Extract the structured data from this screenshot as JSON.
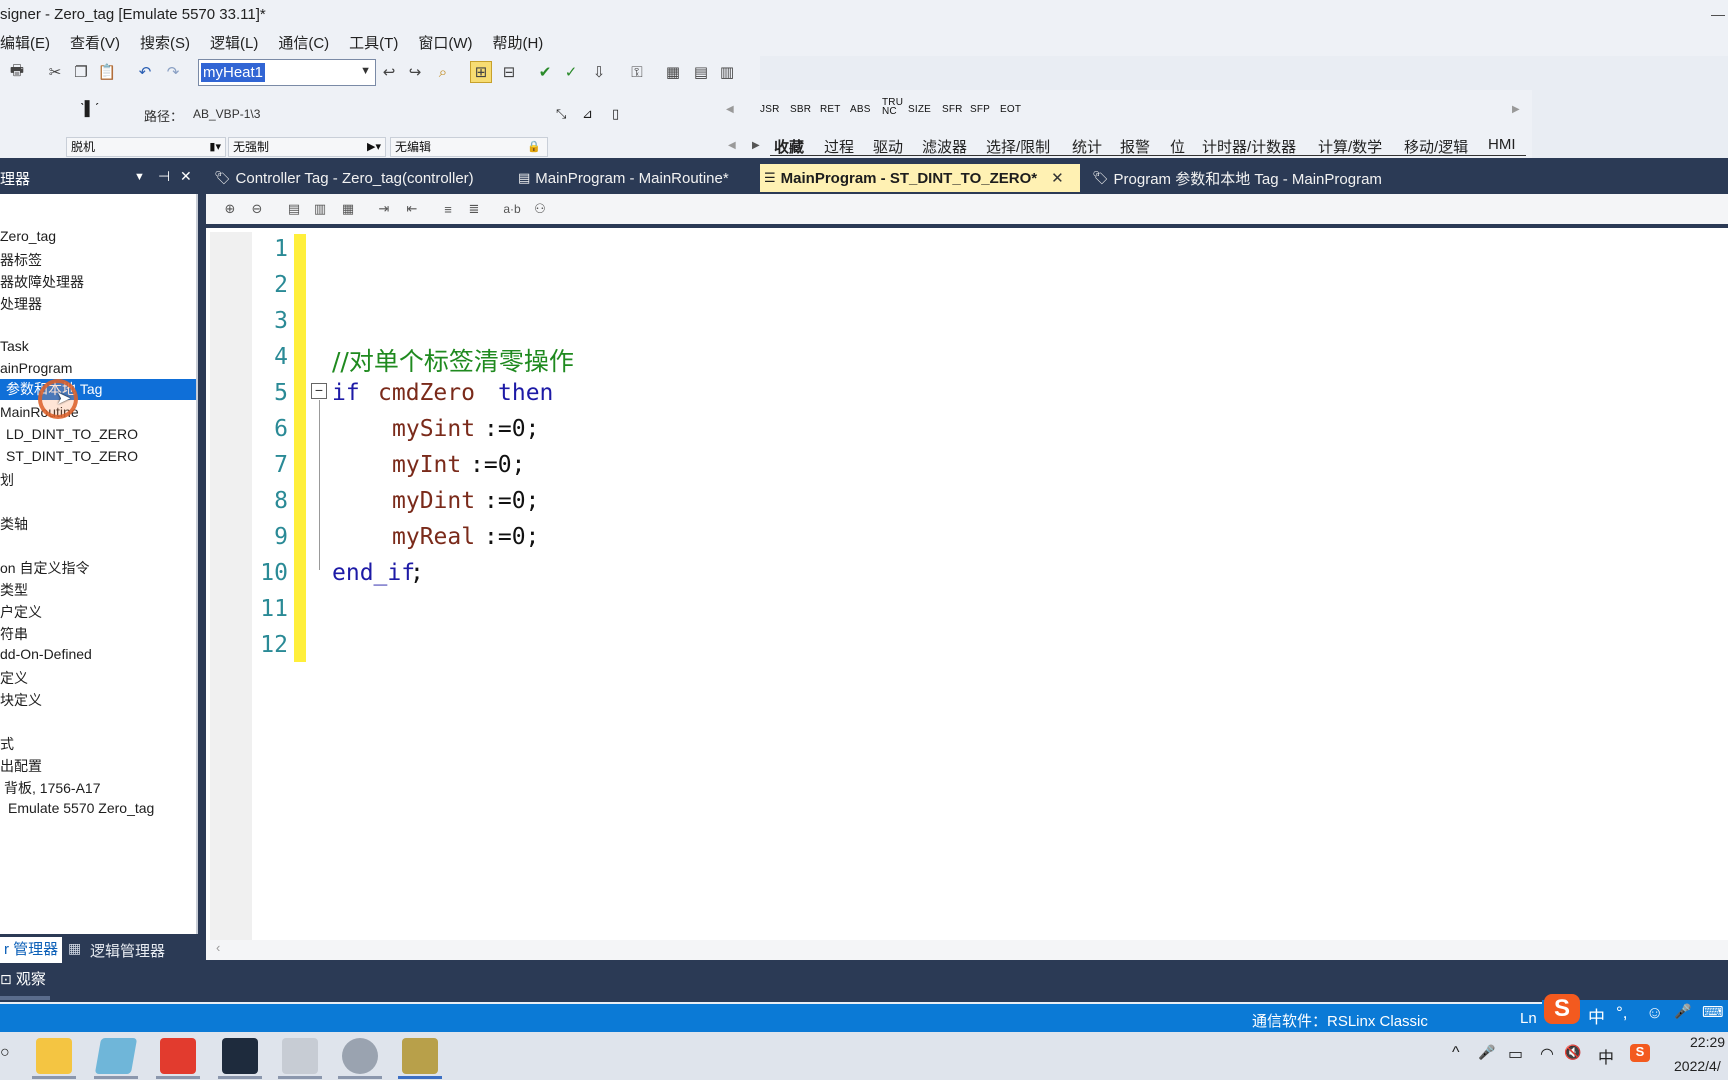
{
  "window": {
    "title": "signer - Zero_tag [Emulate 5570 33.11]*",
    "controls": [
      "—",
      "□"
    ]
  },
  "menu": [
    "编辑(E)",
    "查看(V)",
    "搜索(S)",
    "逻辑(L)",
    "通信(C)",
    "工具(T)",
    "窗口(W)",
    "帮助(H)"
  ],
  "toolbar": {
    "tag_combo_value": "myHeat1"
  },
  "path": {
    "label": "路径：",
    "value": "AB_VBP-1\\3"
  },
  "mode": {
    "run": "脱机",
    "force": "无强制",
    "edit": "无编辑"
  },
  "instructions": {
    "buttons": [
      "JSR",
      "SBR",
      "RET",
      "ABS",
      "TRU NC",
      "SIZE",
      "SFR",
      "SFP",
      "EOT"
    ],
    "tabs": [
      "收藏",
      "过程",
      "驱动",
      "滤波器",
      "选择/限制",
      "统计",
      "报警",
      "位",
      "计时器/计数器",
      "计算/数学",
      "移动/逻辑",
      "HMI"
    ]
  },
  "organizer": {
    "title": "理器",
    "items": [
      "Zero_tag",
      "器标签",
      "器故障处理器",
      "处理器",
      "Task",
      "ainProgram",
      "参数和本地 Tag",
      "MainRoutine",
      "LD_DINT_TO_ZERO",
      "ST_DINT_TO_ZERO",
      "划",
      "类轴",
      "on 自定义指令",
      "类型",
      "户定义",
      "符串",
      "dd-On-Defined",
      "定义",
      "块定义",
      "式",
      "出配置",
      "背板, 1756-A17",
      "Emulate 5570 Zero_tag"
    ],
    "tabs": [
      "r 管理器",
      "逻辑管理器"
    ]
  },
  "doc_tabs": [
    "Controller Tag - Zero_tag(controller)",
    "MainProgram - MainRoutine*",
    "MainProgram - ST_DINT_TO_ZERO*",
    "Program 参数和本地 Tag - MainProgram"
  ],
  "editor": {
    "line_numbers": [
      "1",
      "2",
      "3",
      "4",
      "5",
      "6",
      "7",
      "8",
      "9",
      "10",
      "11",
      "12"
    ],
    "code": {
      "comment": "//对单个标签清零操作",
      "if_kw": "if",
      "cond": "cmdZero",
      "then_kw": "then",
      "l6_var": "mySint",
      "l7_var": "myInt",
      "l8_var": "myDint",
      "l9_var": "myReal",
      "assign": ":=0;",
      "end_kw": "end_if",
      "end_semi": ";"
    }
  },
  "watch": {
    "label": "观察"
  },
  "status": {
    "comm": "通信软件：RSLinx Classic",
    "ln": "Ln"
  },
  "ime": {
    "logo": "S",
    "items": [
      "中",
      "°,",
      "☺",
      "🎤",
      "⌨"
    ]
  },
  "taskbar": {
    "tray": [
      "^",
      "🎤",
      "▭",
      "◠",
      "🔇",
      "中"
    ],
    "time": "22:29",
    "date": "2022/4/"
  },
  "colors": {
    "accent": "#0b7ad6",
    "dark_band": "#2b3a55",
    "active_tab": "#fff1b3",
    "selection": "#0f6fd8",
    "yellow_margin": "#ffef3b"
  }
}
